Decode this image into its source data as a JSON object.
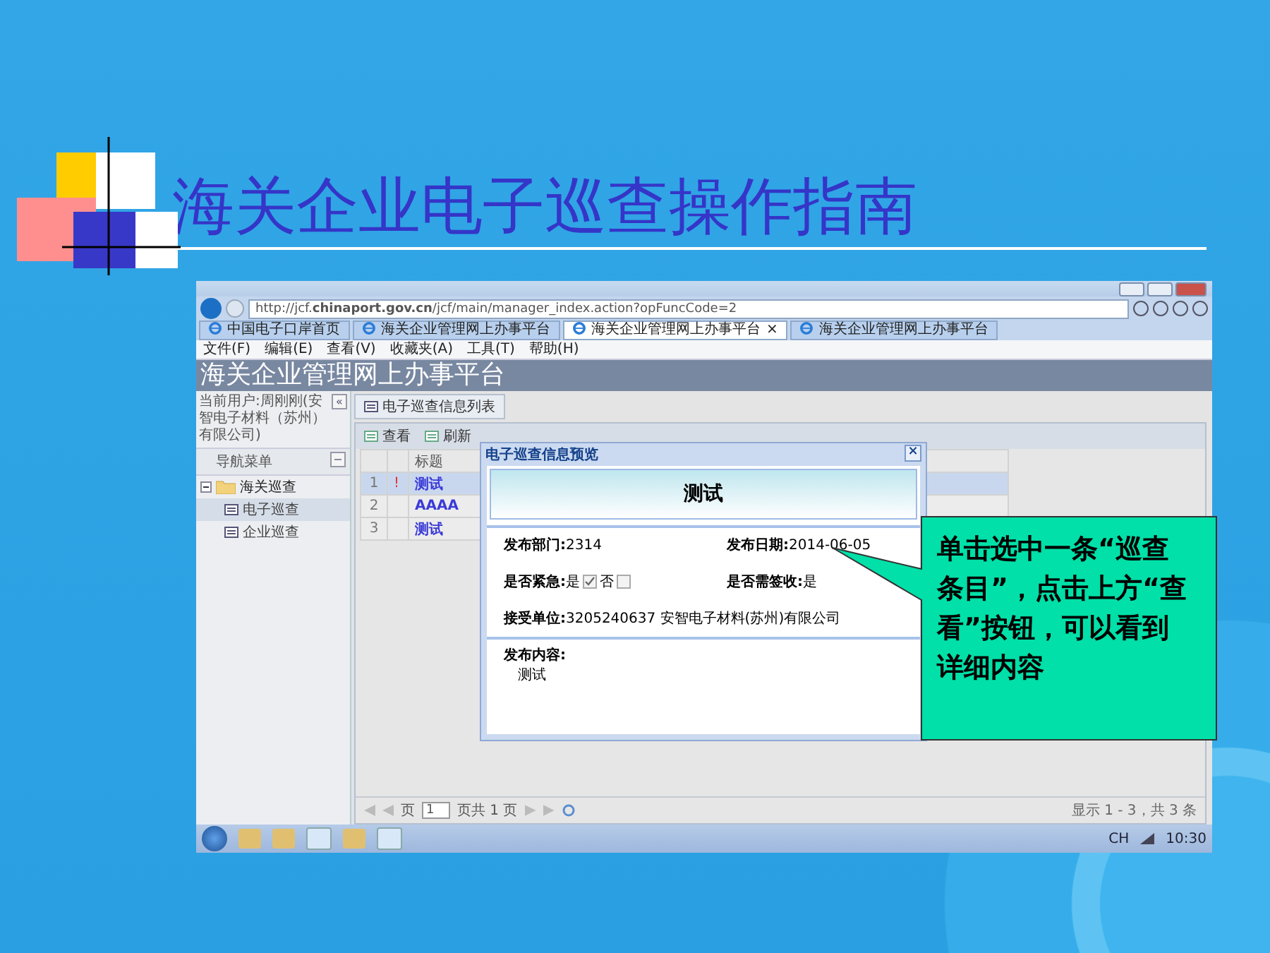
{
  "slide": {
    "title": "海关企业电子巡查操作指南"
  },
  "browser": {
    "address": "http://jcf.**chinaport.gov.cn**/jcf/main/manager_index.action?opFuncCode=2",
    "tabs": [
      {
        "label": "中国电子口岸首页",
        "selected": false
      },
      {
        "label": "海关企业管理网上办事平台",
        "selected": false
      },
      {
        "label": "海关企业管理网上办事平台",
        "selected": true,
        "close": "×"
      },
      {
        "label": "海关企业管理网上办事平台",
        "selected": false
      }
    ],
    "menu": [
      "文件(F)",
      "编辑(E)",
      "查看(V)",
      "收藏夹(A)",
      "工具(T)",
      "帮助(H)"
    ]
  },
  "app": {
    "title": "海关企业管理网上办事平台",
    "sidebar": {
      "user": "当前用户:周刚刚(安智电子材料（苏州）有限公司)",
      "collapse": "«",
      "menu_title": "导航菜单",
      "minimize": "−",
      "tree": [
        {
          "label": "海关巡查",
          "expanded": true,
          "children": [
            {
              "label": "电子巡查",
              "selected": true
            },
            {
              "label": "企业巡查",
              "selected": false
            }
          ]
        }
      ]
    },
    "tab": "电子巡查信息列表",
    "toolbar": [
      "查看",
      "刷新"
    ],
    "table": {
      "columns": [
        "标题"
      ],
      "rows": [
        {
          "num": "1",
          "flag": "!",
          "title": "测试",
          "selected": true
        },
        {
          "num": "2",
          "title": "AAAA",
          "selected": false
        },
        {
          "num": "3",
          "title": "测试",
          "selected": false
        }
      ]
    },
    "pager": {
      "page_label": "页",
      "page": "1",
      "total": "页共 1 页",
      "summary": "显示 1 - 3，共 3 条"
    }
  },
  "dialog": {
    "title": "电子巡查信息预览",
    "close": "×",
    "heading": "测试",
    "dept": {
      "label": "发布部门:",
      "value": "2314"
    },
    "date": {
      "label": "发布日期:",
      "value": "2014-06-05"
    },
    "urgent": {
      "label": "是否紧急:",
      "options": [
        {
          "label": "是",
          "checked": true
        },
        {
          "label": "否",
          "checked": false
        }
      ]
    },
    "sign": {
      "label": "是否需签收:",
      "value": "是"
    },
    "receiver": {
      "label": "接受单位:",
      "value": "3205240637 安智电子材料(苏州)有限公司"
    },
    "content": {
      "label": "发布内容:",
      "value": "测试"
    }
  },
  "taskbar": {
    "lang": "CH",
    "time": "10:30"
  },
  "callout": {
    "text": "单击选中一条“巡查条目”，点击上方“查看”按钮，可以看到详细内容"
  }
}
